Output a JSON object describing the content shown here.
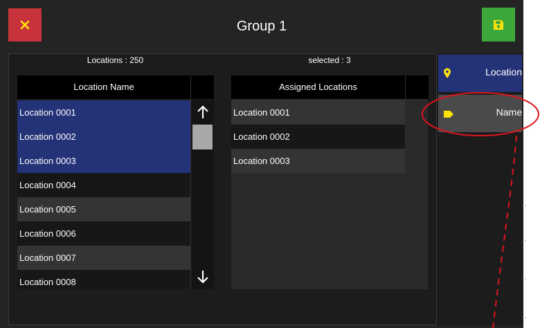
{
  "header": {
    "title": "Group 1",
    "close_icon": "close-x-icon",
    "save_icon": "save-floppy-icon"
  },
  "left_list": {
    "count_label": "Locations : 250",
    "column_header": "Location Name",
    "rows": [
      {
        "label": "Location 0001",
        "selected": true
      },
      {
        "label": "Location 0002",
        "selected": true
      },
      {
        "label": "Location 0003",
        "selected": true
      },
      {
        "label": "Location 0004",
        "selected": false
      },
      {
        "label": "Location 0005",
        "selected": false
      },
      {
        "label": "Location 0006",
        "selected": false
      },
      {
        "label": "Location 0007",
        "selected": false
      },
      {
        "label": "Location 0008",
        "selected": false
      }
    ]
  },
  "right_list": {
    "count_label": "selected : 3",
    "column_header": "Assigned Locations",
    "rows": [
      "Location 0001",
      "Location 0002",
      "Location 0003"
    ]
  },
  "sidebar": {
    "items": [
      {
        "label": "Location",
        "icon": "map-pin-icon"
      },
      {
        "label": "Name",
        "icon": "tag-icon"
      }
    ]
  },
  "colors": {
    "close": "#c8323a",
    "save": "#3ca83c",
    "selected_row": "#243277",
    "sidebar_active": "#243277",
    "sidebar_item": "#4a4a4a",
    "icon_yellow": "#ffe10a",
    "annotation_red": "#e0141e"
  }
}
